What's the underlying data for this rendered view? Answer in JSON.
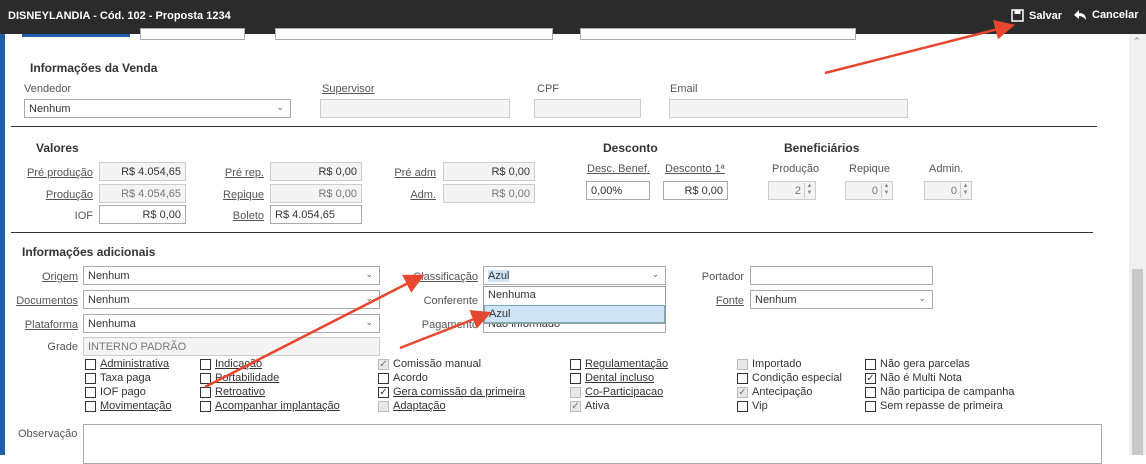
{
  "window": {
    "title": "DISNEYLANDIA - Cód. 102 - Proposta 1234",
    "save": "Salvar",
    "cancel": "Cancelar"
  },
  "venda": {
    "heading": "Informações da Venda",
    "vendedor_label": "Vendedor",
    "vendedor_value": "Nenhum",
    "supervisor_label": "Supervisor",
    "cpf_label": "CPF",
    "email_label": "Email"
  },
  "valores": {
    "heading": "Valores",
    "pre_producao_label": "Pré produção",
    "pre_producao": "R$ 4.054,65",
    "producao_label": "Produção",
    "producao": "R$ 4.054,65",
    "iof_label": "IOF",
    "iof": "R$ 0,00",
    "pre_rep_label": "Pré rep.",
    "pre_rep": "R$ 0,00",
    "repique_label": "Repique",
    "repique": "R$ 0,00",
    "boleto_label": "Boleto",
    "boleto": "R$ 4.054,65",
    "pre_adm_label": "Pré adm",
    "pre_adm": "R$ 0,00",
    "adm_label": "Adm.",
    "adm": "R$ 0,00"
  },
  "desconto": {
    "heading": "Desconto",
    "desc_benef_label": "Desc. Benef.",
    "desc_benef": "0,00%",
    "desconto1_label": "Desconto 1ª",
    "desconto1": "R$ 0,00"
  },
  "beneficiarios": {
    "heading": "Beneficiários",
    "producao_label": "Produção",
    "producao": "2",
    "repique_label": "Repique",
    "repique": "0",
    "admin_label": "Admin.",
    "admin": "0"
  },
  "adicionais": {
    "heading": "Informações adicionais",
    "origem_label": "Origem",
    "origem": "Nenhum",
    "documentos_label": "Documentos",
    "documentos": "Nenhum",
    "plataforma_label": "Plataforma",
    "plataforma": "Nenhuma",
    "grade_label": "Grade",
    "grade": "INTERNO PADRÃO",
    "classificacao_label": "Classificação",
    "classificacao": "Azul",
    "conferente_label": "Conferente",
    "pagamento_label": "Pagamento",
    "pagamento": "Não informado",
    "portador_label": "Portador",
    "fonte_label": "Fonte",
    "fonte": "Nenhum",
    "observacao_label": "Observação"
  },
  "dropdown": {
    "options": [
      "Nenhuma",
      "Azul"
    ]
  },
  "checkboxes": {
    "col1": [
      {
        "label": "Administrativa",
        "checked": false
      },
      {
        "label": "Taxa paga",
        "checked": false
      },
      {
        "label": "IOF pago",
        "checked": false
      },
      {
        "label": "Movimentação",
        "checked": false
      }
    ],
    "col2": [
      {
        "label": "Indicação",
        "checked": false
      },
      {
        "label": "Portabilidade",
        "checked": false
      },
      {
        "label": "Retroativo",
        "checked": false
      },
      {
        "label": "Acompanhar implantação",
        "checked": false
      }
    ],
    "col3": [
      {
        "label": "Comissão manual",
        "checked": true
      },
      {
        "label": "Acordo",
        "checked": false
      },
      {
        "label": "Gera comissão da primeira",
        "checked": true
      },
      {
        "label": "Adaptação",
        "checked": false
      }
    ],
    "col4": [
      {
        "label": "Regulamentação",
        "checked": false
      },
      {
        "label": "Dental incluso",
        "checked": false
      },
      {
        "label": "Co-Participacao",
        "checked": false
      },
      {
        "label": "Ativa",
        "checked": true
      }
    ],
    "col5": [
      {
        "label": "Importado",
        "checked": false
      },
      {
        "label": "Condição especial",
        "checked": false
      },
      {
        "label": "Antecipação",
        "checked": true
      },
      {
        "label": "Vip",
        "checked": false
      }
    ],
    "col6": [
      {
        "label": "Não gera parcelas",
        "checked": false
      },
      {
        "label": "Não é Multi Nota",
        "checked": true
      },
      {
        "label": "Não participa de campanha",
        "checked": false
      },
      {
        "label": "Sem repasse de primeira",
        "checked": false
      }
    ]
  },
  "colors": {
    "titlebar": "#2b2b2b",
    "accent": "#1f5fa8",
    "arrow": "#e8472f",
    "selected": "#cfe4f7"
  }
}
